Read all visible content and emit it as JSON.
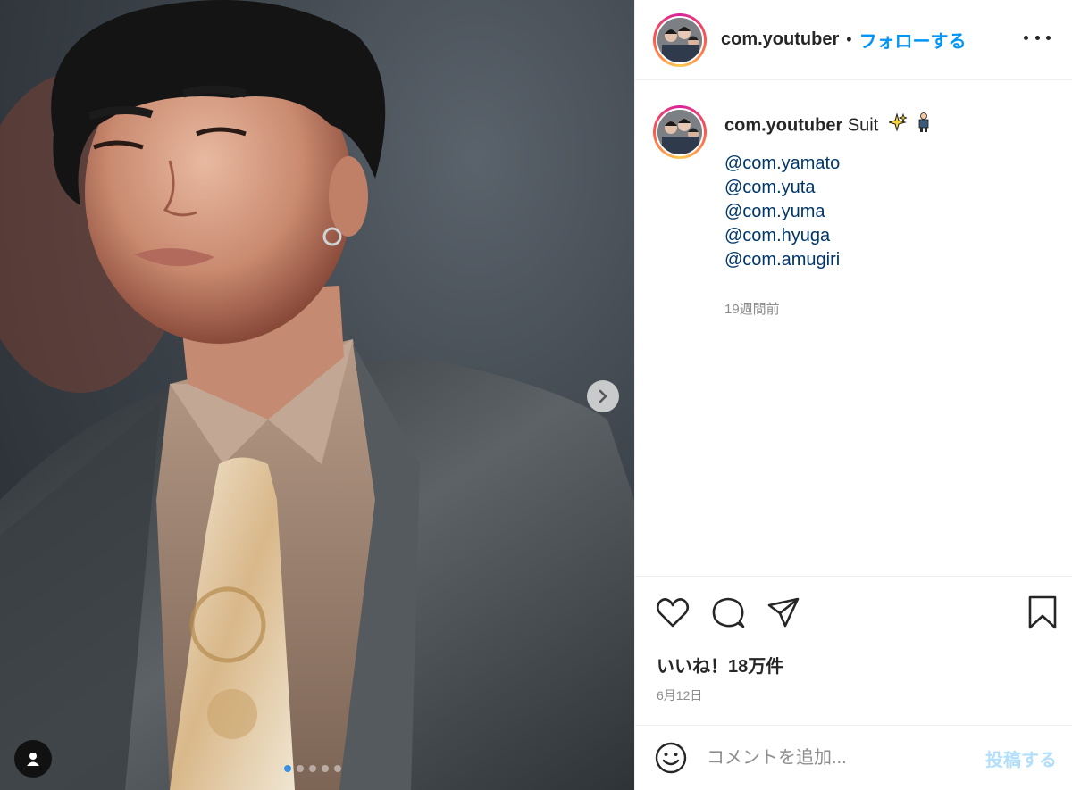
{
  "post": {
    "username": "com.youtuber",
    "follow_label": "フォローする",
    "separator": "•",
    "caption_text": "Suit",
    "caption_emoji": [
      "sparkles-emoji",
      "person-in-suit-emoji"
    ],
    "mentions": [
      "@com.yamato",
      "@com.yuta",
      "@com.yuma",
      "@com.hyuga",
      "@com.amugiri"
    ],
    "time_ago": "19週間前",
    "likes": "いいね！18万件",
    "date": "6月12日"
  },
  "carousel": {
    "slide_count": 5,
    "active_index": 0,
    "next_icon": "chevron-right-icon",
    "user_tag_icon": "user-icon"
  },
  "actions": {
    "icons": [
      "heart-icon",
      "comment-icon",
      "share-icon",
      "bookmark-icon"
    ]
  },
  "comment": {
    "emoji_icon": "smiley-icon",
    "placeholder": "コメントを追加...",
    "post_label": "投稿する"
  },
  "colors": {
    "link": "#00376b",
    "follow": "#0095f6",
    "post_disabled": "#b2dffc",
    "active_dot": "#3d8fe0"
  }
}
